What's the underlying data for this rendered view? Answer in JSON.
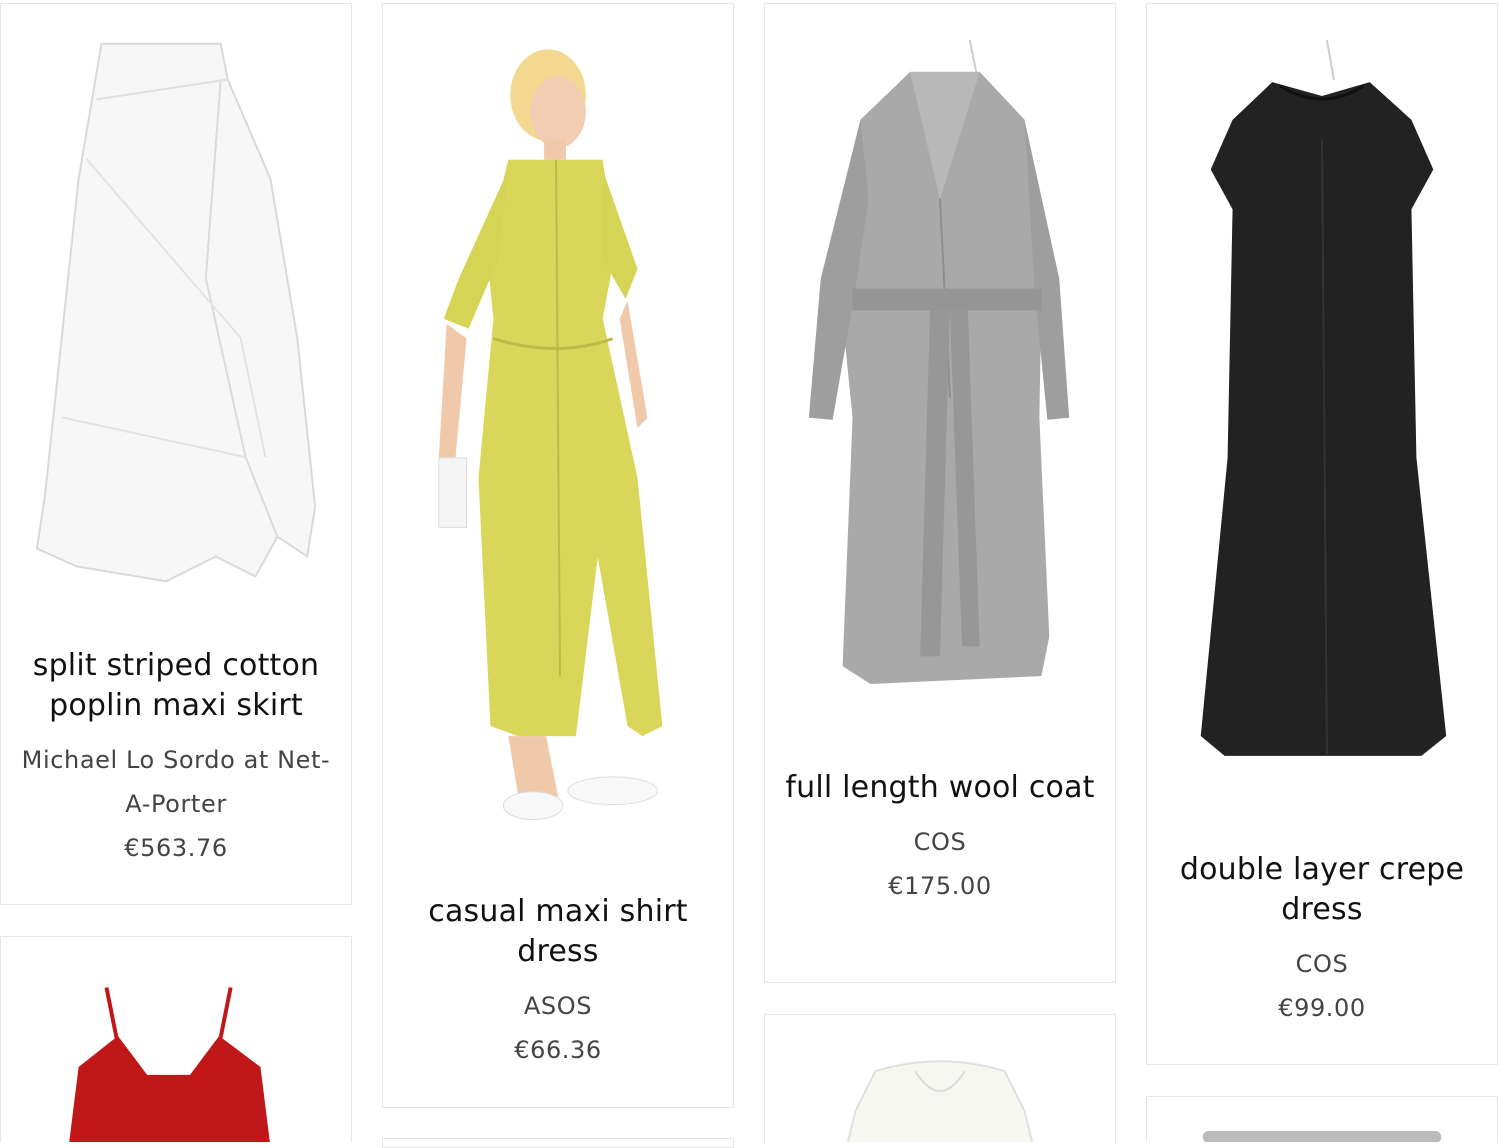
{
  "products": [
    {
      "name": "split striped cotton poplin maxi skirt",
      "store": "Michael Lo Sordo at Net-A-Porter",
      "price": "€563.76"
    },
    {
      "name": "casual maxi shirt dress",
      "store": "ASOS",
      "price": "€66.36"
    },
    {
      "name": "full length wool coat",
      "store": "COS",
      "price": "€175.00"
    },
    {
      "name": "double layer crepe dress",
      "store": "COS",
      "price": "€99.00"
    }
  ],
  "colors": {
    "card_border": "#e6e6e6",
    "text_title": "#111111",
    "text_meta": "#444444",
    "skirt_white": "#f7f7f7",
    "dress_yellow": "#d9d65a",
    "coat_grey": "#a9a9a9",
    "dress_black": "#222222",
    "top_red": "#c01818"
  }
}
